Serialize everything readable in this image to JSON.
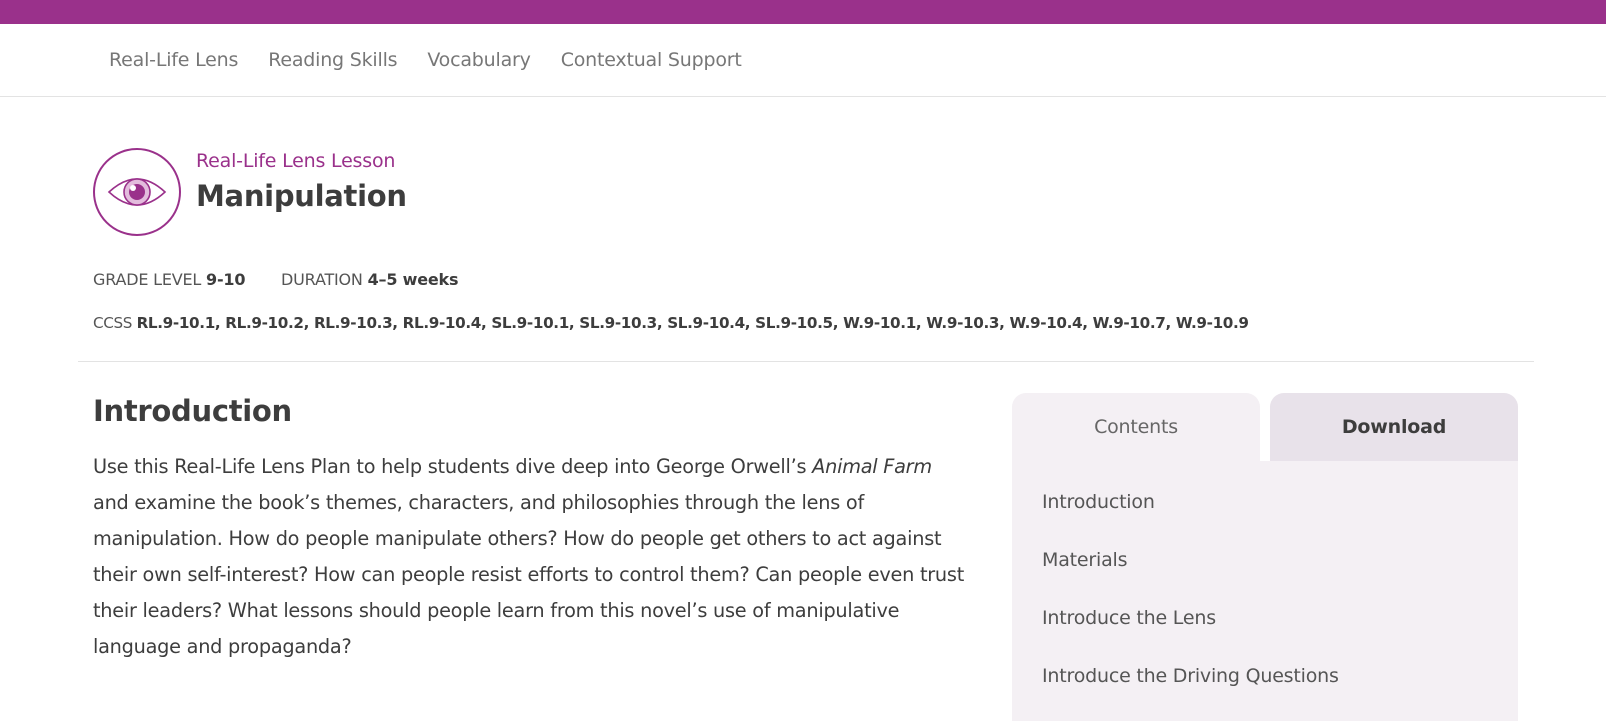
{
  "nav": {
    "items": [
      {
        "label": "Real-Life Lens"
      },
      {
        "label": "Reading Skills"
      },
      {
        "label": "Vocabulary"
      },
      {
        "label": "Contextual Support"
      }
    ]
  },
  "lesson": {
    "kicker": "Real-Life Lens Lesson",
    "title": "Manipulation",
    "icon": "eye-icon",
    "grade_label": "GRADE LEVEL",
    "grade_value": "9-10",
    "duration_label": "DURATION",
    "duration_value": "4–5 weeks",
    "ccss_label": "CCSS",
    "ccss_value": "RL.9-10.1, RL.9-10.2, RL.9-10.3, RL.9-10.4, SL.9-10.1, SL.9-10.3, SL.9-10.4, SL.9-10.5, W.9-10.1, W.9-10.3, W.9-10.4, W.9-10.7, W.9-10.9"
  },
  "intro": {
    "heading": "Introduction",
    "text_before": "Use this Real-Life Lens Plan to help students dive deep into George Orwell’s ",
    "book_title": "Animal Farm",
    "text_after": " and examine the book’s themes, characters, and philosophies through the lens of manipulation. How do people manipulate others? How do people get others to act against their own self-interest? How can people resist efforts to control them? Can people even trust their leaders? What lessons should people learn from this novel’s use of manipulative language and propaganda?"
  },
  "sidebar": {
    "tabs": [
      {
        "label": "Contents",
        "active": true
      },
      {
        "label": "Download",
        "active": false
      }
    ],
    "contents": [
      {
        "label": "Introduction"
      },
      {
        "label": "Materials"
      },
      {
        "label": "Introduce the Lens"
      },
      {
        "label": "Introduce the Driving Questions"
      }
    ]
  },
  "colors": {
    "brand": "#9a318b",
    "text": "#3d3d3d",
    "panel_bg": "#f4f0f4"
  }
}
